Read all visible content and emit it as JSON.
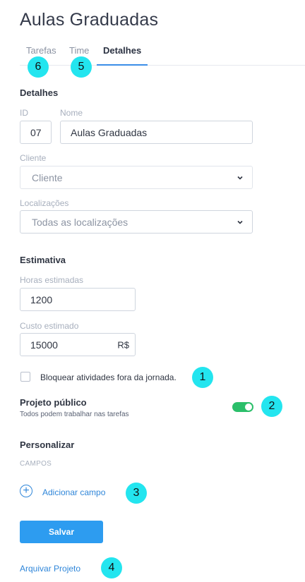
{
  "page": {
    "title": "Aulas Graduadas"
  },
  "tabs": [
    {
      "label": "Tarefas",
      "badge": "6"
    },
    {
      "label": "Time",
      "badge": "5"
    },
    {
      "label": "Detalhes"
    }
  ],
  "detalhes": {
    "section_title": "Detalhes",
    "id_label": "ID",
    "id_value": "07",
    "nome_label": "Nome",
    "nome_value": "Aulas Graduadas",
    "cliente_label": "Cliente",
    "cliente_value": "Cliente",
    "localizacoes_label": "Localizações",
    "localizacoes_value": "Todas as localizações"
  },
  "estimativa": {
    "section_title": "Estimativa",
    "horas_label": "Horas estimadas",
    "horas_value": "1200",
    "custo_label": "Custo estimado",
    "custo_value": "15000",
    "currency": "R$"
  },
  "bloquear": {
    "label": "Bloquear atividades fora da jornada.",
    "checked": false,
    "badge": "1"
  },
  "projeto_publico": {
    "title": "Projeto público",
    "subtitle": "Todos podem trabalhar nas tarefas",
    "enabled": true,
    "badge": "2"
  },
  "personalizar": {
    "title": "Personalizar",
    "campos_label": "CAMPOS",
    "add_field_label": "Adicionar campo",
    "badge": "3"
  },
  "actions": {
    "save_label": "Salvar",
    "archive_label": "Arquivar Projeto",
    "archive_badge": "4"
  },
  "colors": {
    "accent": "#2d9cf0",
    "toggle_on": "#2bbf6a",
    "badge": "#23e5ef",
    "link": "#2f86d9"
  },
  "icons": {
    "dropdown": "chevron-down-icon",
    "add": "plus-circle-icon"
  }
}
